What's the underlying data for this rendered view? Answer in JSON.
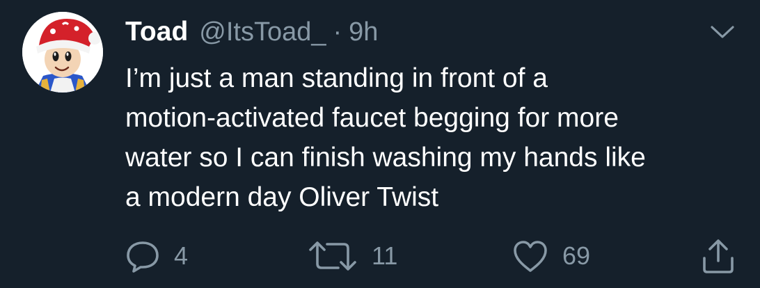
{
  "tweet": {
    "author_name": "Toad",
    "handle": "@ItsToad_",
    "separator": "·",
    "time": "9h",
    "text_lines": [
      "I’m just a man standing in front of a",
      "motion-activated faucet begging for more",
      "water so I can finish washing my hands like",
      "a modern day Oliver Twist"
    ],
    "avatar_icon": "toad-santa-hat-avatar",
    "menu_icon": "chevron-down-icon"
  },
  "actions": {
    "reply": {
      "icon": "reply-icon",
      "count": "4"
    },
    "retweet": {
      "icon": "retweet-icon",
      "count": "11"
    },
    "like": {
      "icon": "heart-icon",
      "count": "69"
    },
    "share": {
      "icon": "share-icon",
      "count": ""
    }
  },
  "colors": {
    "background": "#15202b",
    "primary_text": "#ffffff",
    "secondary_text": "#8899a6"
  }
}
